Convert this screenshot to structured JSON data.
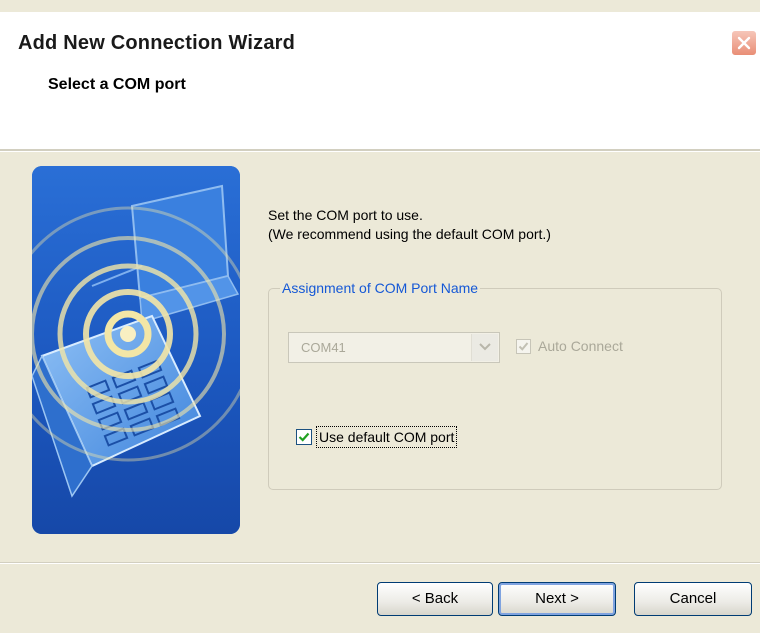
{
  "window": {
    "title": "Add New Connection Wizard",
    "close_icon": "close-icon"
  },
  "header": {
    "title": "Select a COM port"
  },
  "illustration": {
    "icon": "wireless-phone-illustration"
  },
  "instructions": {
    "line1": "Set the COM port to use.",
    "line2": "(We recommend using the default COM port.)"
  },
  "group": {
    "legend": "Assignment of COM Port Name",
    "com_port": {
      "value": "COM41",
      "enabled": false
    },
    "auto_connect": {
      "label": "Auto Connect",
      "checked": true,
      "enabled": false
    },
    "use_default": {
      "label": "Use default COM port",
      "checked": true
    }
  },
  "buttons": {
    "back": "< Back",
    "next": "Next >",
    "cancel": "Cancel"
  },
  "colors": {
    "dialog_bg": "#ECE9D8",
    "legend_blue": "#1558D6",
    "button_border": "#003C74",
    "illustration_blue": "#1F62C8"
  }
}
